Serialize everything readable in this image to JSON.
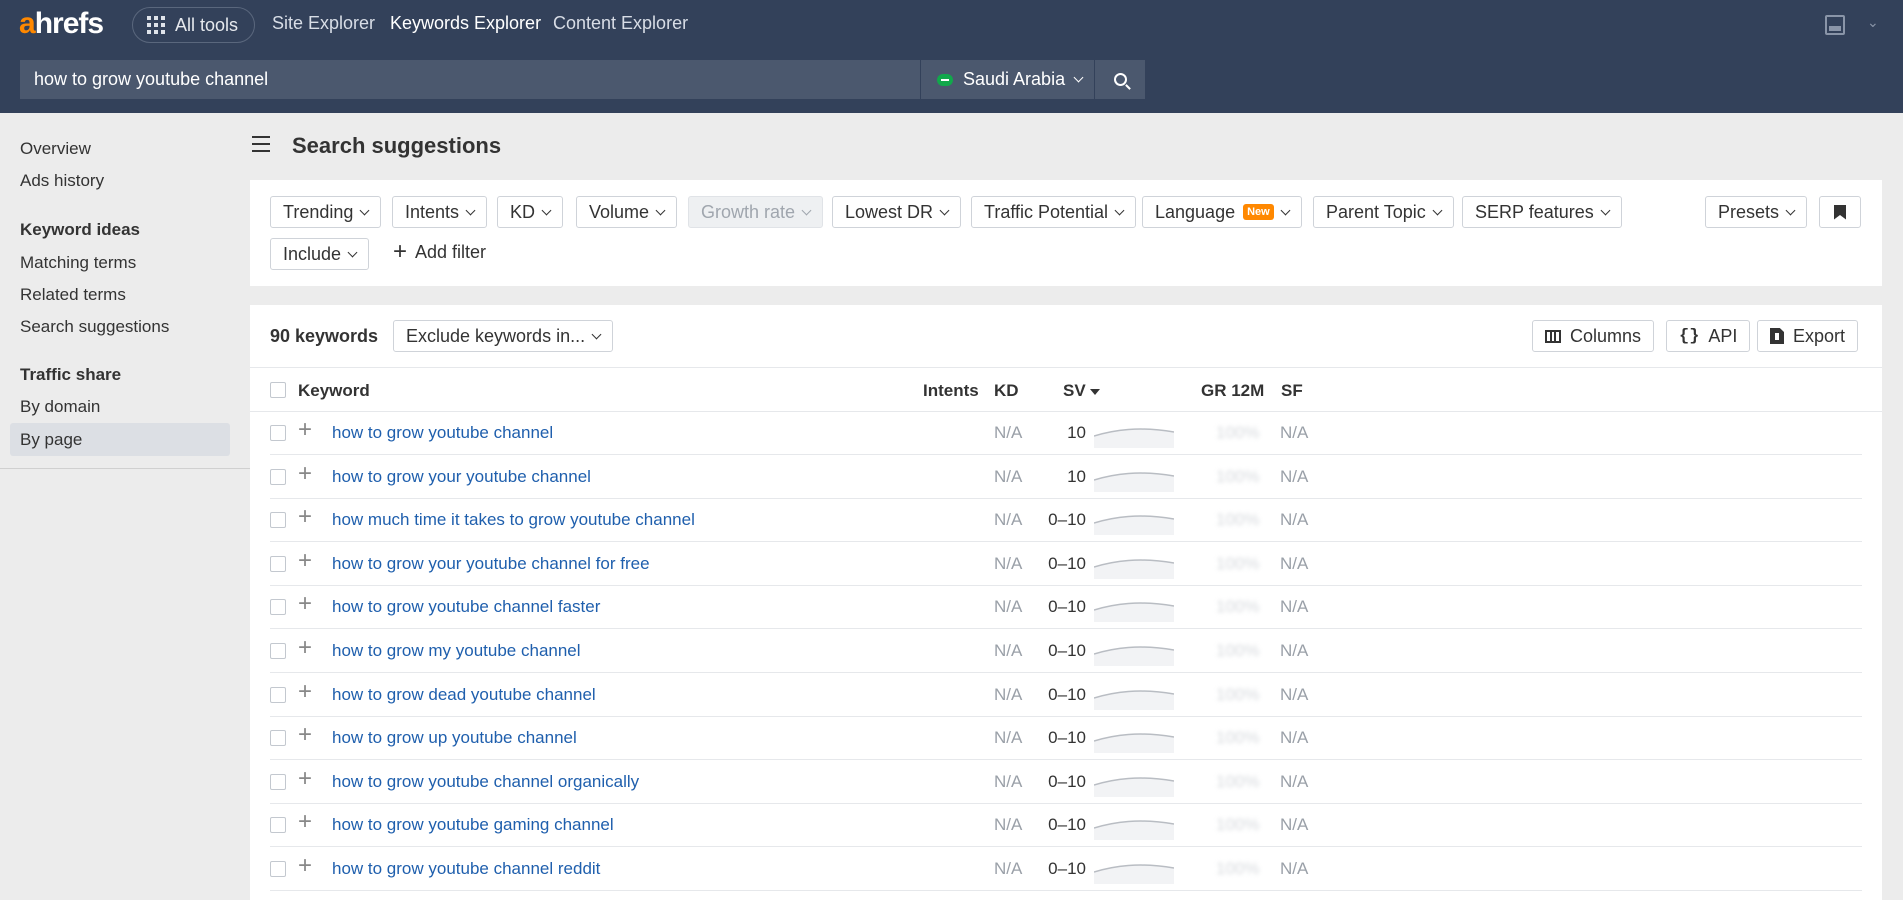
{
  "header": {
    "logo": "ahrefs",
    "all_tools": "All tools",
    "nav": [
      "Site Explorer",
      "Keywords Explorer",
      "Content Explorer"
    ],
    "active_nav": "Keywords Explorer",
    "search_value": "how to grow youtube channel",
    "country": "Saudi Arabia"
  },
  "sidebar": {
    "items_top": [
      "Overview",
      "Ads history"
    ],
    "keyword_ideas_heading": "Keyword ideas",
    "keyword_ideas": [
      "Matching terms",
      "Related terms",
      "Search suggestions"
    ],
    "active_item": "Search suggestions",
    "traffic_share_heading": "Traffic share",
    "traffic_share": [
      "By domain",
      "By page"
    ]
  },
  "page_title": "Search suggestions",
  "filters": {
    "buttons": [
      "Trending",
      "Intents",
      "KD",
      "Volume",
      "Growth rate",
      "Lowest DR",
      "Traffic Potential",
      "Language",
      "Parent Topic",
      "SERP features"
    ],
    "disabled": "Growth rate",
    "new_badge": "New",
    "presets": "Presets",
    "include": "Include",
    "add_filter": "Add filter"
  },
  "results": {
    "count_label": "90 keywords",
    "exclude_label": "Exclude keywords in...",
    "columns_label": "Columns",
    "api_label": "API",
    "export_label": "Export"
  },
  "table": {
    "headers": {
      "keyword": "Keyword",
      "intents": "Intents",
      "kd": "KD",
      "sv": "SV",
      "gr": "GR 12M",
      "sf": "SF"
    },
    "rows": [
      {
        "keyword": "how to grow youtube channel",
        "kd": "N/A",
        "sv": "10",
        "gr": "100%",
        "sf": "N/A"
      },
      {
        "keyword": "how to grow your youtube channel",
        "kd": "N/A",
        "sv": "10",
        "gr": "100%",
        "sf": "N/A"
      },
      {
        "keyword": "how much time it takes to grow youtube channel",
        "kd": "N/A",
        "sv": "0–10",
        "gr": "100%",
        "sf": "N/A"
      },
      {
        "keyword": "how to grow your youtube channel for free",
        "kd": "N/A",
        "sv": "0–10",
        "gr": "100%",
        "sf": "N/A"
      },
      {
        "keyword": "how to grow youtube channel faster",
        "kd": "N/A",
        "sv": "0–10",
        "gr": "100%",
        "sf": "N/A"
      },
      {
        "keyword": "how to grow my youtube channel",
        "kd": "N/A",
        "sv": "0–10",
        "gr": "100%",
        "sf": "N/A"
      },
      {
        "keyword": "how to grow dead youtube channel",
        "kd": "N/A",
        "sv": "0–10",
        "gr": "100%",
        "sf": "N/A"
      },
      {
        "keyword": "how to grow up youtube channel",
        "kd": "N/A",
        "sv": "0–10",
        "gr": "100%",
        "sf": "N/A"
      },
      {
        "keyword": "how to grow youtube channel organically",
        "kd": "N/A",
        "sv": "0–10",
        "gr": "100%",
        "sf": "N/A"
      },
      {
        "keyword": "how to grow youtube gaming channel",
        "kd": "N/A",
        "sv": "0–10",
        "gr": "100%",
        "sf": "N/A"
      },
      {
        "keyword": "how to grow youtube channel reddit",
        "kd": "N/A",
        "sv": "0–10",
        "gr": "100%",
        "sf": "N/A"
      }
    ]
  },
  "colors": {
    "topbar": "#33415a",
    "accent": "#ff8800",
    "link": "#1f5fad"
  }
}
